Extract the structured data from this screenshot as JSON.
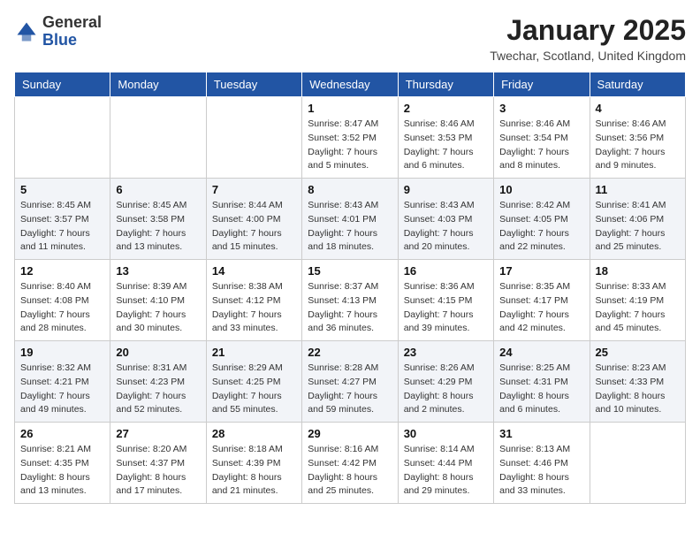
{
  "header": {
    "logo_general": "General",
    "logo_blue": "Blue",
    "month_title": "January 2025",
    "location": "Twechar, Scotland, United Kingdom"
  },
  "weekdays": [
    "Sunday",
    "Monday",
    "Tuesday",
    "Wednesday",
    "Thursday",
    "Friday",
    "Saturday"
  ],
  "weeks": [
    [
      {
        "day": "",
        "sunrise": "",
        "sunset": "",
        "daylight": ""
      },
      {
        "day": "",
        "sunrise": "",
        "sunset": "",
        "daylight": ""
      },
      {
        "day": "",
        "sunrise": "",
        "sunset": "",
        "daylight": ""
      },
      {
        "day": "1",
        "sunrise": "Sunrise: 8:47 AM",
        "sunset": "Sunset: 3:52 PM",
        "daylight": "Daylight: 7 hours and 5 minutes."
      },
      {
        "day": "2",
        "sunrise": "Sunrise: 8:46 AM",
        "sunset": "Sunset: 3:53 PM",
        "daylight": "Daylight: 7 hours and 6 minutes."
      },
      {
        "day": "3",
        "sunrise": "Sunrise: 8:46 AM",
        "sunset": "Sunset: 3:54 PM",
        "daylight": "Daylight: 7 hours and 8 minutes."
      },
      {
        "day": "4",
        "sunrise": "Sunrise: 8:46 AM",
        "sunset": "Sunset: 3:56 PM",
        "daylight": "Daylight: 7 hours and 9 minutes."
      }
    ],
    [
      {
        "day": "5",
        "sunrise": "Sunrise: 8:45 AM",
        "sunset": "Sunset: 3:57 PM",
        "daylight": "Daylight: 7 hours and 11 minutes."
      },
      {
        "day": "6",
        "sunrise": "Sunrise: 8:45 AM",
        "sunset": "Sunset: 3:58 PM",
        "daylight": "Daylight: 7 hours and 13 minutes."
      },
      {
        "day": "7",
        "sunrise": "Sunrise: 8:44 AM",
        "sunset": "Sunset: 4:00 PM",
        "daylight": "Daylight: 7 hours and 15 minutes."
      },
      {
        "day": "8",
        "sunrise": "Sunrise: 8:43 AM",
        "sunset": "Sunset: 4:01 PM",
        "daylight": "Daylight: 7 hours and 18 minutes."
      },
      {
        "day": "9",
        "sunrise": "Sunrise: 8:43 AM",
        "sunset": "Sunset: 4:03 PM",
        "daylight": "Daylight: 7 hours and 20 minutes."
      },
      {
        "day": "10",
        "sunrise": "Sunrise: 8:42 AM",
        "sunset": "Sunset: 4:05 PM",
        "daylight": "Daylight: 7 hours and 22 minutes."
      },
      {
        "day": "11",
        "sunrise": "Sunrise: 8:41 AM",
        "sunset": "Sunset: 4:06 PM",
        "daylight": "Daylight: 7 hours and 25 minutes."
      }
    ],
    [
      {
        "day": "12",
        "sunrise": "Sunrise: 8:40 AM",
        "sunset": "Sunset: 4:08 PM",
        "daylight": "Daylight: 7 hours and 28 minutes."
      },
      {
        "day": "13",
        "sunrise": "Sunrise: 8:39 AM",
        "sunset": "Sunset: 4:10 PM",
        "daylight": "Daylight: 7 hours and 30 minutes."
      },
      {
        "day": "14",
        "sunrise": "Sunrise: 8:38 AM",
        "sunset": "Sunset: 4:12 PM",
        "daylight": "Daylight: 7 hours and 33 minutes."
      },
      {
        "day": "15",
        "sunrise": "Sunrise: 8:37 AM",
        "sunset": "Sunset: 4:13 PM",
        "daylight": "Daylight: 7 hours and 36 minutes."
      },
      {
        "day": "16",
        "sunrise": "Sunrise: 8:36 AM",
        "sunset": "Sunset: 4:15 PM",
        "daylight": "Daylight: 7 hours and 39 minutes."
      },
      {
        "day": "17",
        "sunrise": "Sunrise: 8:35 AM",
        "sunset": "Sunset: 4:17 PM",
        "daylight": "Daylight: 7 hours and 42 minutes."
      },
      {
        "day": "18",
        "sunrise": "Sunrise: 8:33 AM",
        "sunset": "Sunset: 4:19 PM",
        "daylight": "Daylight: 7 hours and 45 minutes."
      }
    ],
    [
      {
        "day": "19",
        "sunrise": "Sunrise: 8:32 AM",
        "sunset": "Sunset: 4:21 PM",
        "daylight": "Daylight: 7 hours and 49 minutes."
      },
      {
        "day": "20",
        "sunrise": "Sunrise: 8:31 AM",
        "sunset": "Sunset: 4:23 PM",
        "daylight": "Daylight: 7 hours and 52 minutes."
      },
      {
        "day": "21",
        "sunrise": "Sunrise: 8:29 AM",
        "sunset": "Sunset: 4:25 PM",
        "daylight": "Daylight: 7 hours and 55 minutes."
      },
      {
        "day": "22",
        "sunrise": "Sunrise: 8:28 AM",
        "sunset": "Sunset: 4:27 PM",
        "daylight": "Daylight: 7 hours and 59 minutes."
      },
      {
        "day": "23",
        "sunrise": "Sunrise: 8:26 AM",
        "sunset": "Sunset: 4:29 PM",
        "daylight": "Daylight: 8 hours and 2 minutes."
      },
      {
        "day": "24",
        "sunrise": "Sunrise: 8:25 AM",
        "sunset": "Sunset: 4:31 PM",
        "daylight": "Daylight: 8 hours and 6 minutes."
      },
      {
        "day": "25",
        "sunrise": "Sunrise: 8:23 AM",
        "sunset": "Sunset: 4:33 PM",
        "daylight": "Daylight: 8 hours and 10 minutes."
      }
    ],
    [
      {
        "day": "26",
        "sunrise": "Sunrise: 8:21 AM",
        "sunset": "Sunset: 4:35 PM",
        "daylight": "Daylight: 8 hours and 13 minutes."
      },
      {
        "day": "27",
        "sunrise": "Sunrise: 8:20 AM",
        "sunset": "Sunset: 4:37 PM",
        "daylight": "Daylight: 8 hours and 17 minutes."
      },
      {
        "day": "28",
        "sunrise": "Sunrise: 8:18 AM",
        "sunset": "Sunset: 4:39 PM",
        "daylight": "Daylight: 8 hours and 21 minutes."
      },
      {
        "day": "29",
        "sunrise": "Sunrise: 8:16 AM",
        "sunset": "Sunset: 4:42 PM",
        "daylight": "Daylight: 8 hours and 25 minutes."
      },
      {
        "day": "30",
        "sunrise": "Sunrise: 8:14 AM",
        "sunset": "Sunset: 4:44 PM",
        "daylight": "Daylight: 8 hours and 29 minutes."
      },
      {
        "day": "31",
        "sunrise": "Sunrise: 8:13 AM",
        "sunset": "Sunset: 4:46 PM",
        "daylight": "Daylight: 8 hours and 33 minutes."
      },
      {
        "day": "",
        "sunrise": "",
        "sunset": "",
        "daylight": ""
      }
    ]
  ]
}
